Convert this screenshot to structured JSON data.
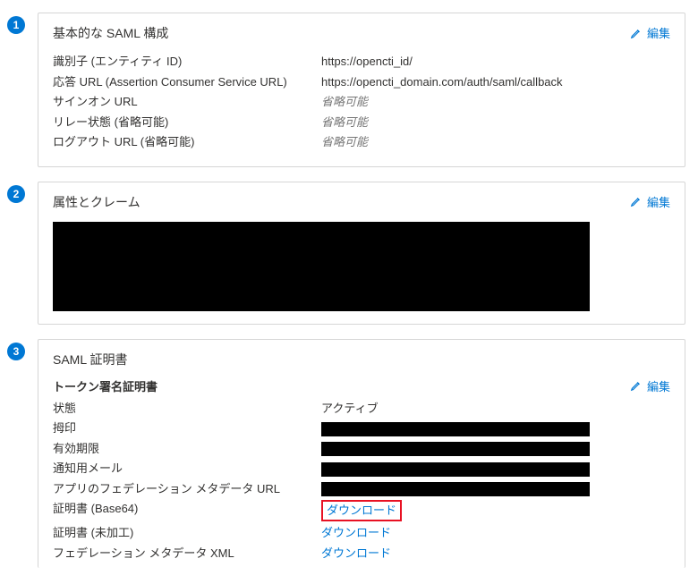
{
  "common": {
    "edit_label": "編集"
  },
  "card1": {
    "badge": "1",
    "title": "基本的な SAML 構成",
    "rows": [
      {
        "label": "識別子 (エンティティ ID)",
        "value": "https://opencti_id/",
        "optional": false
      },
      {
        "label": "応答 URL (Assertion Consumer Service URL)",
        "value": "https://opencti_domain.com/auth/saml/callback",
        "optional": false
      },
      {
        "label": "サインオン URL",
        "value": "省略可能",
        "optional": true
      },
      {
        "label": "リレー状態 (省略可能)",
        "value": "省略可能",
        "optional": true
      },
      {
        "label": "ログアウト URL (省略可能)",
        "value": "省略可能",
        "optional": true
      }
    ]
  },
  "card2": {
    "badge": "2",
    "title": "属性とクレーム"
  },
  "card3": {
    "badge": "3",
    "title": "SAML 証明書",
    "sub": "トークン署名証明書",
    "status_label": "状態",
    "status_value": "アクティブ",
    "thumbprint_label": "拇印",
    "expiry_label": "有効期限",
    "email_label": "通知用メール",
    "fedmeta_label": "アプリのフェデレーション メタデータ URL",
    "cert64_label": "証明書 (Base64)",
    "certraw_label": "証明書 (未加工)",
    "fedxml_label": "フェデレーション メタデータ XML",
    "download_label": "ダウンロード"
  }
}
